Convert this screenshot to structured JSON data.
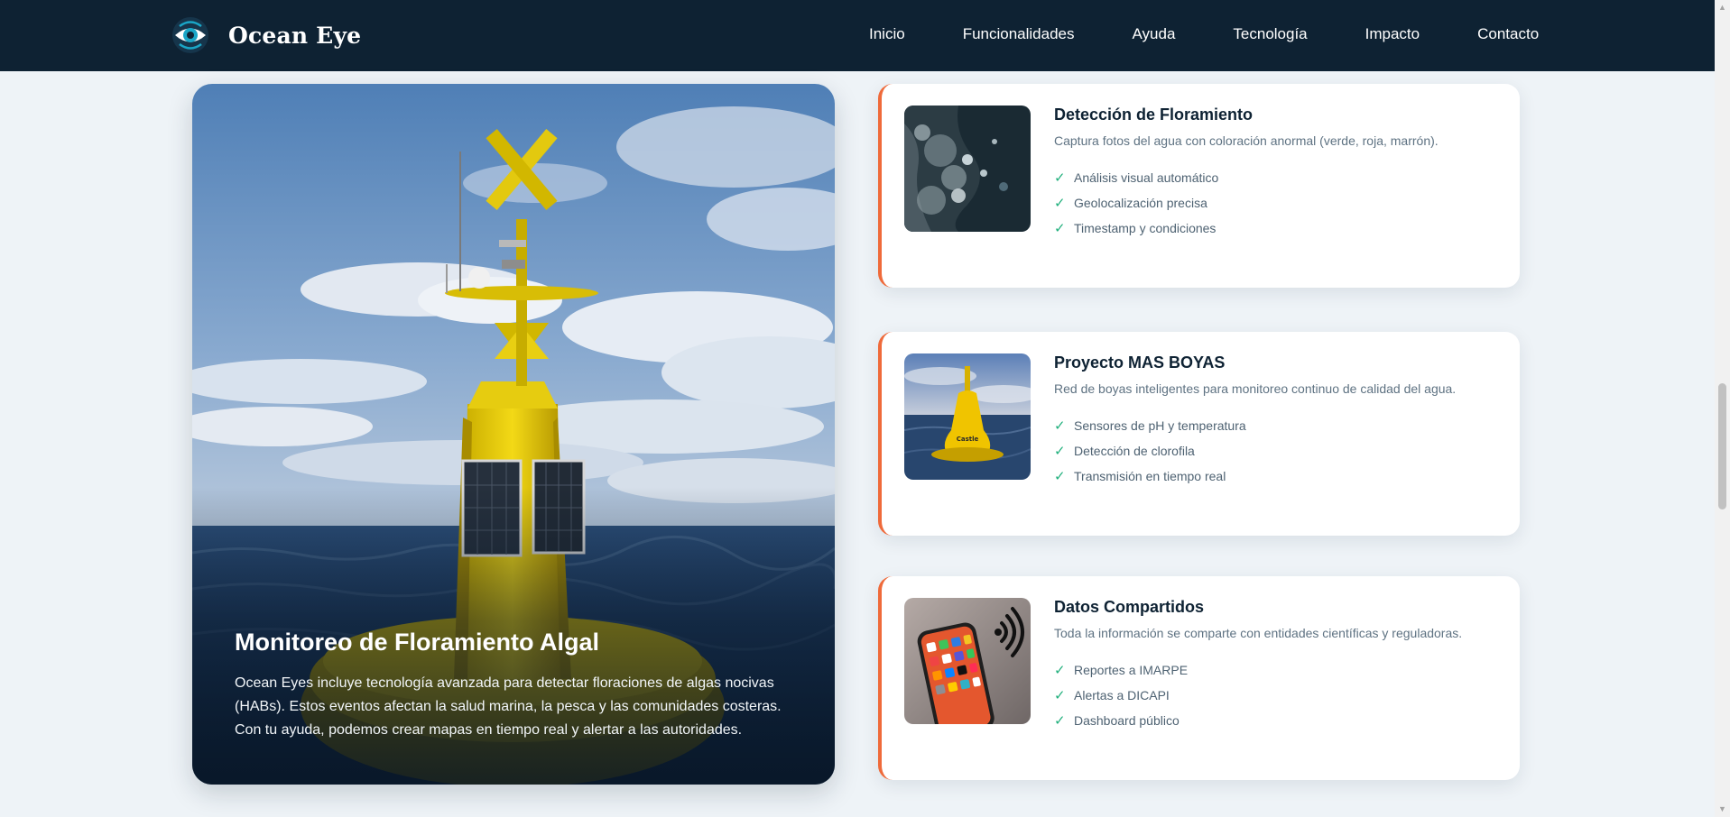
{
  "navbar": {
    "brand": "Ocean Eye",
    "logo_icon": "eye-icon",
    "links": [
      "Inicio",
      "Funcionalidades",
      "Ayuda",
      "Tecnología",
      "Impacto",
      "Contacto"
    ]
  },
  "hero": {
    "title": "Monitoreo de Floramiento Algal",
    "text": "Ocean Eyes incluye tecnología avanzada para detectar floraciones de algas nocivas (HABs). Estos eventos afectan la salud marina, la pesca y las comunidades costeras. Con tu ayuda, podemos crear mapas en tiempo real y alertar a las autoridades."
  },
  "cards": [
    {
      "title": "Detección de Floramiento",
      "description": "Captura fotos del agua con coloración anormal (verde, roja, marrón).",
      "items": [
        "Análisis visual automático",
        "Geolocalización precisa",
        "Timestamp y condiciones"
      ]
    },
    {
      "title": "Proyecto MAS BOYAS",
      "description": "Red de boyas inteligentes para monitoreo continuo de calidad del agua.",
      "items": [
        "Sensores de pH y temperatura",
        "Detección de clorofila",
        "Transmisión en tiempo real"
      ]
    },
    {
      "title": "Datos Compartidos",
      "description": "Toda la información se comparte con entidades científicas y reguladoras.",
      "items": [
        "Reportes a IMARPE",
        "Alertas a DICAPI",
        "Dashboard público"
      ]
    }
  ],
  "colors": {
    "navbar_bg": "#0e2233",
    "accent": "#ef6a3a",
    "check": "#22b07d",
    "page_bg": "#eef3f7"
  }
}
